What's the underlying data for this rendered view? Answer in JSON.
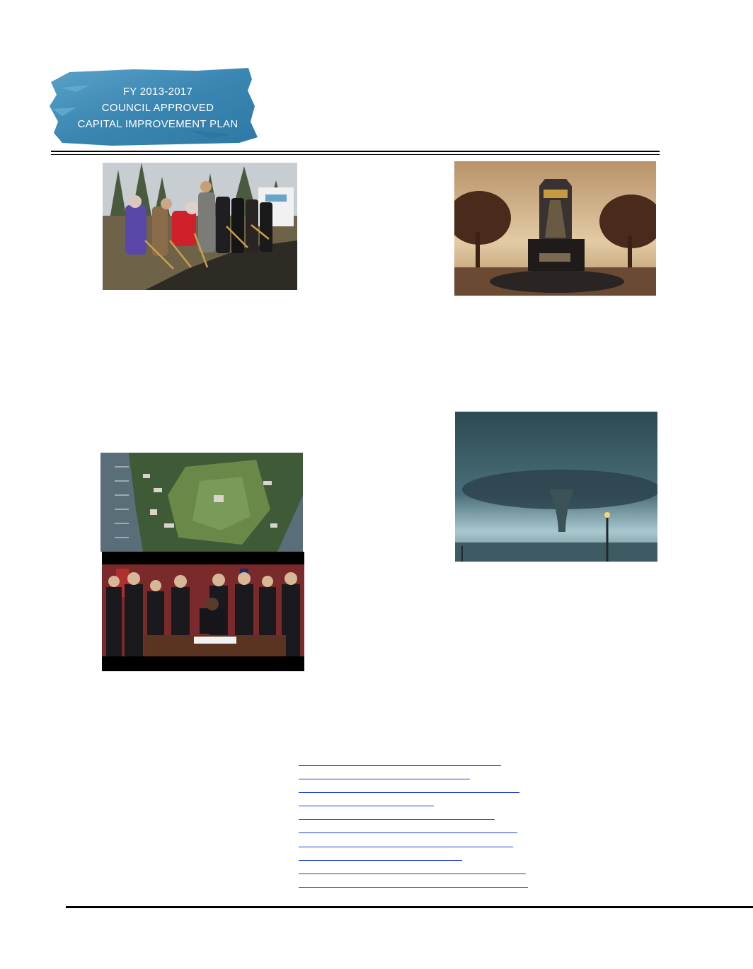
{
  "header": {
    "banner_lines": [
      "FY 2013-2017",
      "COUNCIL APPROVED",
      "CAPITAL IMPROVEMENT PLAN"
    ],
    "banner_color": "#3f8bb5"
  },
  "photos": [
    {
      "name": "groundbreaking-photo"
    },
    {
      "name": "monument-rendering-photo"
    },
    {
      "name": "fort-aerial-photo"
    },
    {
      "name": "bill-signing-photo"
    },
    {
      "name": "tornado-photo"
    }
  ],
  "links": {
    "color": "#1f3fcf",
    "count": 10
  }
}
